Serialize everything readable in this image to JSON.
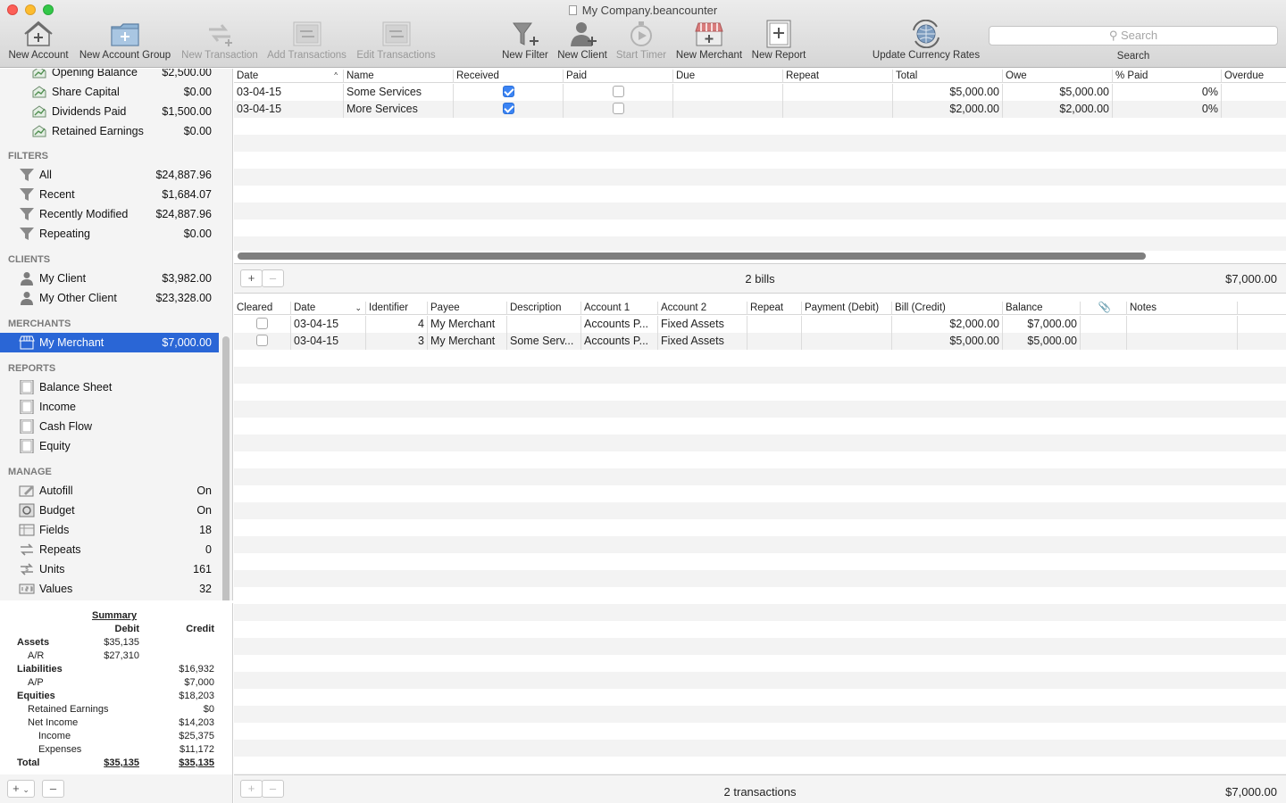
{
  "window": {
    "title": "My Company.beancounter"
  },
  "toolbar": {
    "new_account": "New Account",
    "new_account_group": "New Account Group",
    "new_transaction": "New Transaction",
    "add_transactions": "Add Transactions",
    "edit_transactions": "Edit Transactions",
    "new_filter": "New Filter",
    "new_client": "New Client",
    "start_timer": "Start Timer",
    "new_merchant": "New Merchant",
    "new_report": "New Report",
    "update_currency": "Update Currency Rates",
    "search_placeholder": "Search",
    "search_label": "Search"
  },
  "sidebar": {
    "equity_items": [
      {
        "name": "Opening Balance",
        "value": "$2,500.00"
      },
      {
        "name": "Share Capital",
        "value": "$0.00"
      },
      {
        "name": "Dividends Paid",
        "value": "$1,500.00"
      },
      {
        "name": "Retained Earnings",
        "value": "$0.00"
      }
    ],
    "filters_title": "FILTERS",
    "filters": [
      {
        "name": "All",
        "value": "$24,887.96"
      },
      {
        "name": "Recent",
        "value": "$1,684.07"
      },
      {
        "name": "Recently Modified",
        "value": "$24,887.96"
      },
      {
        "name": "Repeating",
        "value": "$0.00"
      }
    ],
    "clients_title": "CLIENTS",
    "clients": [
      {
        "name": "My Client",
        "value": "$3,982.00"
      },
      {
        "name": "My Other Client",
        "value": "$23,328.00"
      }
    ],
    "merchants_title": "MERCHANTS",
    "merchants": [
      {
        "name": "My Merchant",
        "value": "$7,000.00"
      }
    ],
    "reports_title": "REPORTS",
    "reports": [
      "Balance Sheet",
      "Income",
      "Cash Flow",
      "Equity"
    ],
    "manage_title": "MANAGE",
    "manage": [
      {
        "name": "Autofill",
        "value": "On"
      },
      {
        "name": "Budget",
        "value": "On"
      },
      {
        "name": "Fields",
        "value": "18"
      },
      {
        "name": "Repeats",
        "value": "0"
      },
      {
        "name": "Units",
        "value": "161"
      },
      {
        "name": "Values",
        "value": "32"
      }
    ]
  },
  "summary": {
    "title": "Summary",
    "debit": "Debit",
    "credit": "Credit",
    "rows": [
      {
        "label": "Assets",
        "debit": "$35,135",
        "credit": ""
      },
      {
        "label": "A/R",
        "debit": "$27,310",
        "credit": ""
      },
      {
        "label": "Liabilities",
        "debit": "",
        "credit": "$16,932"
      },
      {
        "label": "A/P",
        "debit": "",
        "credit": "$7,000"
      },
      {
        "label": "Equities",
        "debit": "",
        "credit": "$18,203"
      },
      {
        "label": "Retained Earnings",
        "debit": "",
        "credit": "$0"
      },
      {
        "label": "Net Income",
        "debit": "",
        "credit": "$14,203"
      },
      {
        "label": "Income",
        "debit": "",
        "credit": "$25,375"
      },
      {
        "label": "Expenses",
        "debit": "",
        "credit": "$11,172"
      },
      {
        "label": "Total",
        "debit": "$35,135",
        "credit": "$35,135"
      }
    ]
  },
  "bills": {
    "columns": [
      "Date",
      "Name",
      "Received",
      "Paid",
      "Due",
      "Repeat",
      "Total",
      "Owe",
      "% Paid",
      "Overdue"
    ],
    "rows": [
      {
        "date": "03-04-15",
        "name": "Some Services",
        "received": true,
        "paid": false,
        "due": "",
        "repeat": "",
        "total": "$5,000.00",
        "owe": "$5,000.00",
        "pct": "0%",
        "overdue": ""
      },
      {
        "date": "03-04-15",
        "name": "More Services",
        "received": true,
        "paid": false,
        "due": "",
        "repeat": "",
        "total": "$2,000.00",
        "owe": "$2,000.00",
        "pct": "0%",
        "overdue": ""
      }
    ],
    "count_label": "2 bills",
    "total": "$7,000.00"
  },
  "transactions": {
    "columns": [
      "Cleared",
      "Date",
      "Identifier",
      "Payee",
      "Description",
      "Account 1",
      "Account 2",
      "Repeat",
      "Payment (Debit)",
      "Bill (Credit)",
      "Balance",
      "",
      "Notes"
    ],
    "rows": [
      {
        "cleared": false,
        "date": "03-04-15",
        "id": "4",
        "payee": "My Merchant",
        "desc": "",
        "acc1": "Accounts P...",
        "acc2": "Fixed Assets",
        "repeat": "",
        "payment": "",
        "bill": "$2,000.00",
        "balance": "$7,000.00",
        "notes": ""
      },
      {
        "cleared": false,
        "date": "03-04-15",
        "id": "3",
        "payee": "My Merchant",
        "desc": "Some Serv...",
        "acc1": "Accounts P...",
        "acc2": "Fixed Assets",
        "repeat": "",
        "payment": "",
        "bill": "$5,000.00",
        "balance": "$5,000.00",
        "notes": ""
      }
    ],
    "count_label": "2 transactions",
    "total": "$7,000.00"
  }
}
